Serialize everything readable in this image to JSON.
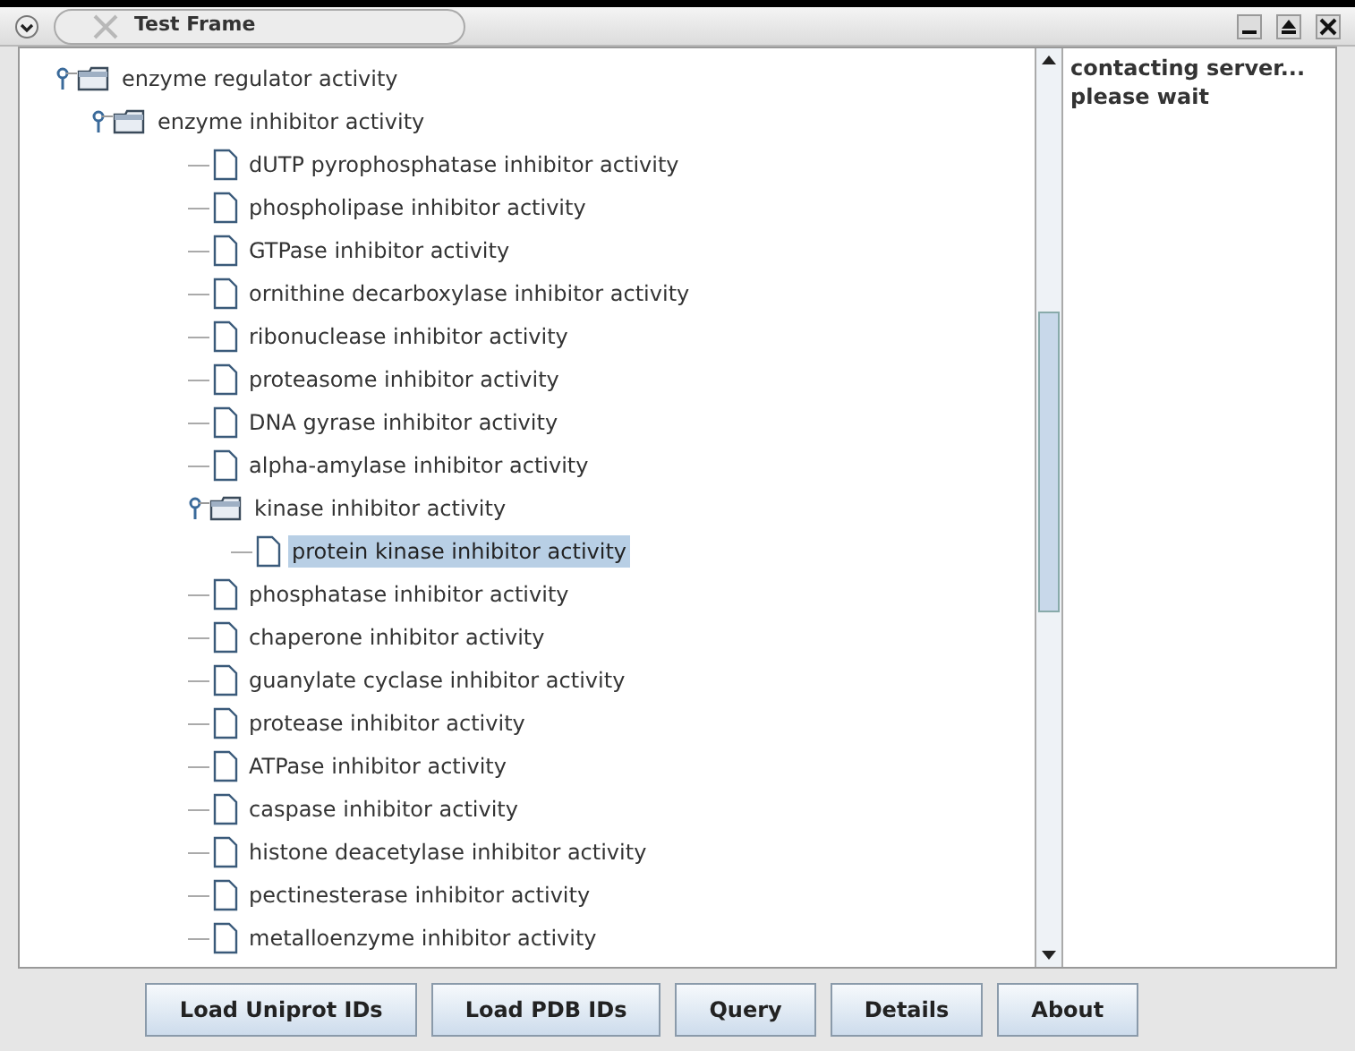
{
  "window": {
    "title": "Test Frame"
  },
  "tree": [
    {
      "label": "enzyme regulator activity",
      "kind": "folder",
      "expanded": true,
      "selected": false,
      "children": [
        {
          "label": "enzyme inhibitor activity",
          "kind": "folder",
          "expanded": true,
          "selected": false,
          "children": [
            {
              "label": "dUTP pyrophosphatase inhibitor activity",
              "kind": "leaf",
              "selected": false
            },
            {
              "label": "phospholipase inhibitor activity",
              "kind": "leaf",
              "selected": false
            },
            {
              "label": "GTPase inhibitor activity",
              "kind": "leaf",
              "selected": false
            },
            {
              "label": "ornithine decarboxylase inhibitor activity",
              "kind": "leaf",
              "selected": false
            },
            {
              "label": "ribonuclease inhibitor activity",
              "kind": "leaf",
              "selected": false
            },
            {
              "label": "proteasome inhibitor activity",
              "kind": "leaf",
              "selected": false
            },
            {
              "label": "DNA gyrase inhibitor activity",
              "kind": "leaf",
              "selected": false
            },
            {
              "label": "alpha-amylase inhibitor activity",
              "kind": "leaf",
              "selected": false
            },
            {
              "label": "kinase inhibitor activity",
              "kind": "folder",
              "expanded": true,
              "selected": false,
              "children": [
                {
                  "label": "protein kinase inhibitor activity",
                  "kind": "leaf",
                  "selected": true
                }
              ]
            },
            {
              "label": "phosphatase inhibitor activity",
              "kind": "leaf",
              "selected": false
            },
            {
              "label": "chaperone inhibitor activity",
              "kind": "leaf",
              "selected": false
            },
            {
              "label": "guanylate cyclase inhibitor activity",
              "kind": "leaf",
              "selected": false
            },
            {
              "label": "protease inhibitor activity",
              "kind": "leaf",
              "selected": false
            },
            {
              "label": "ATPase inhibitor activity",
              "kind": "leaf",
              "selected": false
            },
            {
              "label": "caspase inhibitor activity",
              "kind": "leaf",
              "selected": false
            },
            {
              "label": "histone deacetylase inhibitor activity",
              "kind": "leaf",
              "selected": false
            },
            {
              "label": "pectinesterase inhibitor activity",
              "kind": "leaf",
              "selected": false
            },
            {
              "label": "metalloenzyme inhibitor activity",
              "kind": "leaf",
              "selected": false
            }
          ]
        }
      ]
    }
  ],
  "status_lines": [
    "contacting server...",
    "please wait"
  ],
  "buttons": [
    "Load Uniprot IDs",
    "Load PDB IDs",
    "Query",
    "Details",
    "About"
  ]
}
